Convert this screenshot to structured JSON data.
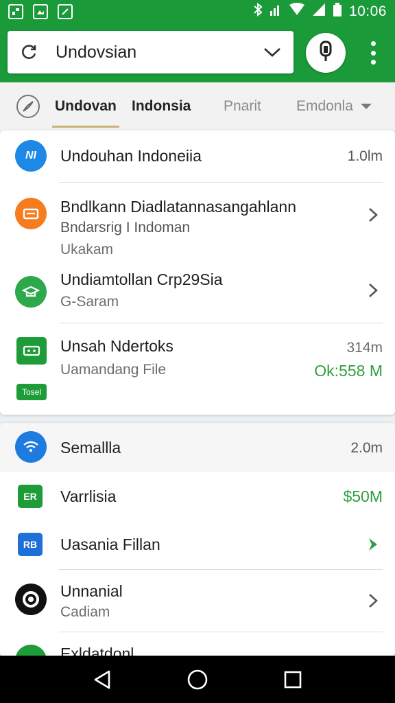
{
  "status_bar": {
    "time": "10:06",
    "left_icons": [
      "gallery-icon",
      "photo-icon",
      "edit-icon"
    ],
    "right_icons": [
      "bluetooth-icon",
      "signal-icon",
      "wifi-icon",
      "cellular-icon",
      "battery-icon"
    ]
  },
  "app_bar": {
    "search_value": "Undovsian",
    "colors": {
      "primary": "#1b9a3a",
      "accent": "#2e9e3e"
    }
  },
  "tabs": [
    {
      "label": "Undovan",
      "state": "active"
    },
    {
      "label": "Indonsia",
      "state": "bold"
    },
    {
      "label": "Pnarit",
      "state": "dim"
    },
    {
      "label": "Emdonla",
      "state": "dim"
    }
  ],
  "card1": {
    "items": [
      {
        "icon_text": "NI",
        "title": "Undouhan Indoneiia",
        "meta": "1.0lm"
      },
      {
        "title": "Bndlkann Diadlatannasangahlann",
        "sub1": "Bndarsrig I Indoman",
        "sub2": "Ukakam"
      },
      {
        "title": "Undiamtollan Crp29Sia",
        "sub1": "G-Saram"
      },
      {
        "title": "Unsah Ndertoks",
        "sub1": "Uamandang File",
        "meta": "314m",
        "meta2": "Ok:558 M",
        "badge": "Tosel"
      }
    ]
  },
  "card2": {
    "items": [
      {
        "title": "Semallla",
        "meta": "2.0m"
      },
      {
        "icon_text": "ER",
        "title": "Varrlisia",
        "meta": "$50M"
      },
      {
        "icon_text": "RB",
        "title": "Uasania Fillan"
      },
      {
        "title": "Unnanial",
        "sub1": "Cadiam"
      },
      {
        "title": "Exldatdonl"
      }
    ]
  }
}
